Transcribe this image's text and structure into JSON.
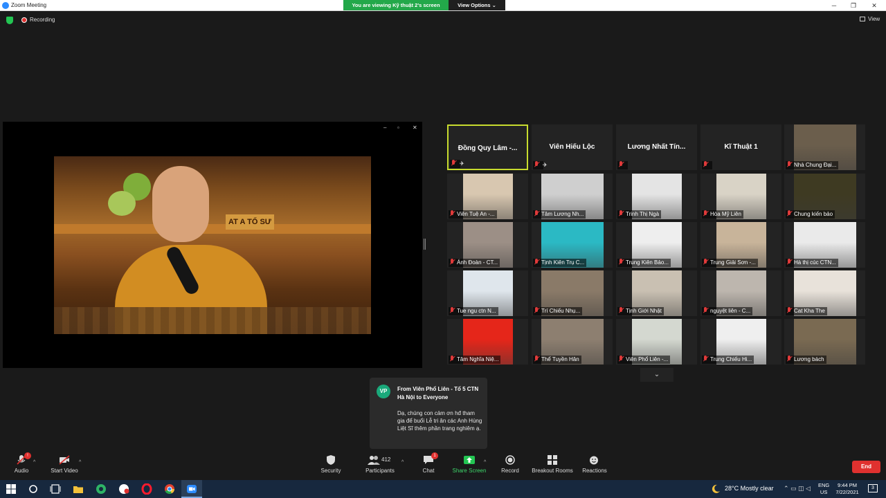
{
  "window": {
    "title": "Zoom Meeting",
    "minimize": "─",
    "restore": "❐",
    "close": "✕"
  },
  "banner": {
    "viewing": "You are viewing Kỹ thuật 2's screen",
    "view_options": "View Options ⌄"
  },
  "status": {
    "recording": "Recording",
    "view": "View"
  },
  "share_window": {
    "minimize": "–",
    "restore": "▫",
    "close": "✕",
    "plaque_text": "AT A TỔ SƯ"
  },
  "gallery": {
    "tiles": [
      {
        "name": "Đồng Quy Lâm -...",
        "type": "name",
        "pinned": true,
        "active": true
      },
      {
        "name": "Viên Hiếu Lộc",
        "type": "name",
        "pinned": true
      },
      {
        "name": "Lương Nhất Tín...",
        "type": "name"
      },
      {
        "name": "Kĩ Thuật 1",
        "type": "name"
      },
      {
        "name": "Nhà Chung Đại...",
        "type": "video",
        "color": "#6b5e4c"
      },
      {
        "name": "Viên Tuệ An -...",
        "type": "video",
        "color": "#d8c7b0"
      },
      {
        "name": "Tâm Lương Nh...",
        "type": "video",
        "color": "#cfcfcf"
      },
      {
        "name": "Trinh Thị Ngà",
        "type": "video",
        "color": "#e4e4e4"
      },
      {
        "name": "Hòa Mỹ Liên",
        "type": "video",
        "color": "#d9d3c6"
      },
      {
        "name": "Chung kiến bảo",
        "type": "video",
        "color": "#3e3a22"
      },
      {
        "name": "Ánh Đoàn - CT...",
        "type": "video",
        "color": "#9c8f86"
      },
      {
        "name": "Tịnh Kiên Trụ C...",
        "type": "video",
        "color": "#2bb9c4"
      },
      {
        "name": "Trung Kiên Bảo...",
        "type": "video",
        "color": "#eeeeee"
      },
      {
        "name": "Trung Giải Sơn -...",
        "type": "video",
        "color": "#c8b49a"
      },
      {
        "name": "Hà thị cúc CTN...",
        "type": "video",
        "color": "#eaeaea"
      },
      {
        "name": "Tue ngu ctn N...",
        "type": "video",
        "color": "#dfe6ec"
      },
      {
        "name": "Trí Chiếu Nhụ...",
        "type": "video",
        "color": "#8a7a68"
      },
      {
        "name": "Tịnh Giới Nhật",
        "type": "video",
        "color": "#c9c0b2"
      },
      {
        "name": "nguyệt liên - C...",
        "type": "video",
        "color": "#bdb6ae"
      },
      {
        "name": "Cat Kha The",
        "type": "video",
        "color": "#e8e2da"
      },
      {
        "name": "Tâm Nghĩa Niệ...",
        "type": "video",
        "color": "#e5261a"
      },
      {
        "name": "Thể Tuyền Hân",
        "type": "video",
        "color": "#8d7f70"
      },
      {
        "name": "Viên Phổ Liên -...",
        "type": "video",
        "color": "#d4d8d0"
      },
      {
        "name": "Trung Chiếu Hi...",
        "type": "video",
        "color": "#efefef"
      },
      {
        "name": "Lương bách",
        "type": "video",
        "color": "#7a6a52"
      }
    ],
    "more": "⌄"
  },
  "chat_toast": {
    "initials": "VP",
    "from": "From Viên Phổ Liên - Tổ 5 CTN Hà Nội to Everyone",
    "message": "Dạ, chúng con cảm ơn hđ tham gia để buổi Lễ tri ân các Anh Hùng Liệt Sĩ thêm phần trang nghiêm ạ."
  },
  "toolbar": {
    "audio": "Audio",
    "start_video": "Start Video",
    "security": "Security",
    "participants": "Participants",
    "participants_count": "412",
    "chat": "Chat",
    "chat_badge": "1",
    "share_screen": "Share Screen",
    "record": "Record",
    "breakout": "Breakout Rooms",
    "reactions": "Reactions",
    "end": "End",
    "audio_badge": "!",
    "caret": "^"
  },
  "taskbar": {
    "weather": "28°C  Mostly clear",
    "lang_top": "ENG",
    "lang_bottom": "US",
    "time": "9:44 PM",
    "date": "7/22/2021",
    "notif": "3",
    "tray_icons": "⌃  ▭  ◫  ◁"
  }
}
